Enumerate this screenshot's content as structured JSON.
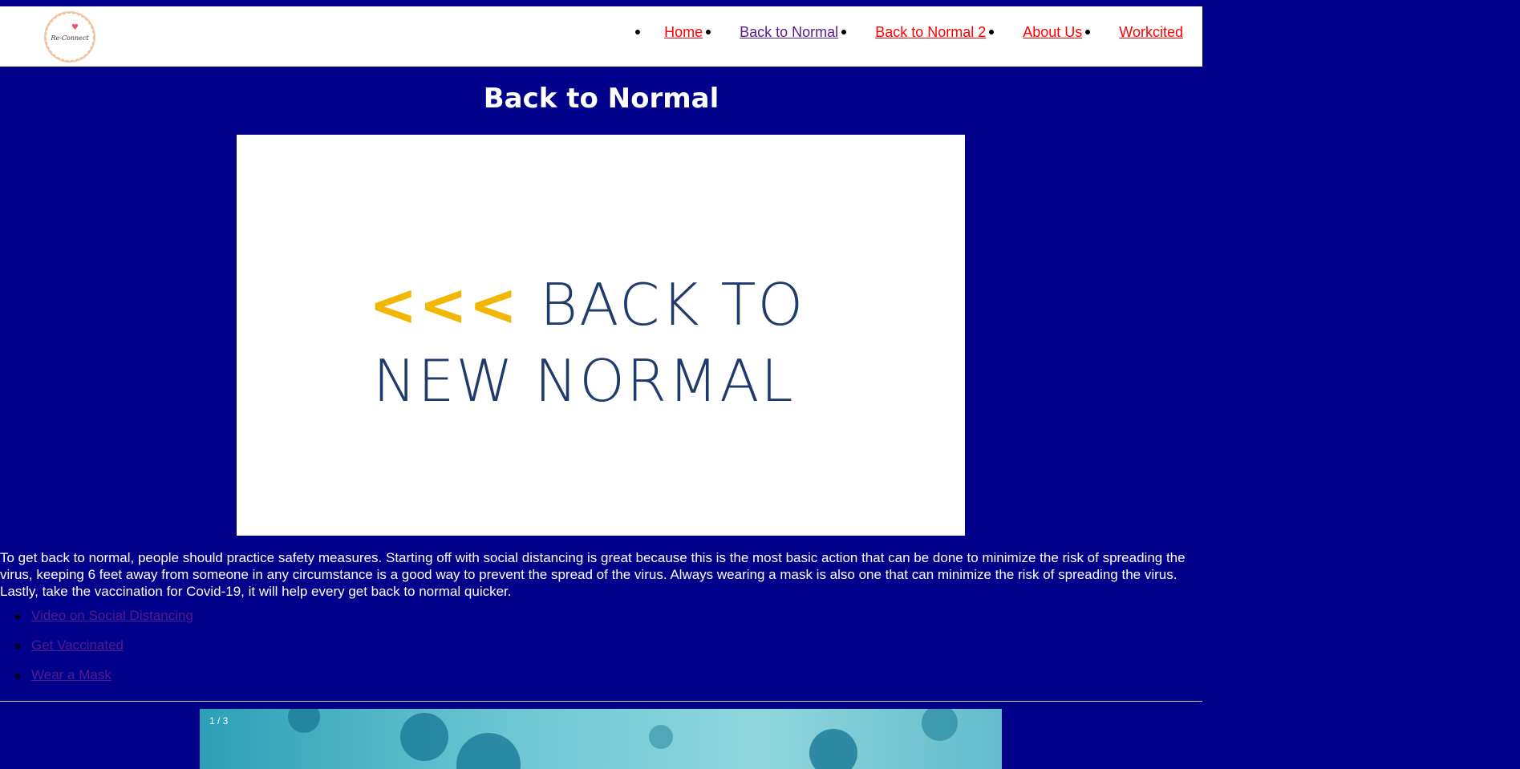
{
  "header": {
    "logo_text": "Re-Connect",
    "nav": [
      {
        "label": "Home",
        "color": "#ff0000"
      },
      {
        "label": "Back to Normal",
        "color": "#551a8b"
      },
      {
        "label": "Back to Normal 2",
        "color": "#ff0000"
      },
      {
        "label": "About Us",
        "color": "#ff0000"
      },
      {
        "label": "Workcited",
        "color": "#ff0000"
      }
    ]
  },
  "page": {
    "title": "Back to Normal",
    "hero": {
      "chevrons": "<<<",
      "line1": "BACK TO",
      "line2": "NEW NORMAL"
    },
    "paragraph": "To get back to normal, people should practice safety measures. Starting off with social distancing is great because this is the most basic action that can be done to minimize the risk of spreading the virus, keeping 6 feet away from someone in any circumstance is a good way to prevent the spread of the virus. Always wearing a mask is also one that can minimize the risk of spreading the virus. Lastly, take the vaccination for Covid-19, it will help every get back to normal quicker.",
    "links": [
      "Video on Social Distancing",
      "Get Vaccinated",
      "Wear a Mask"
    ],
    "slideshow": {
      "counter": "1 / 3"
    }
  },
  "colors": {
    "background": "#00008b",
    "header_bg": "#ffffff",
    "accent_yellow": "#f2b705",
    "text_navy": "#1f3a6b"
  }
}
